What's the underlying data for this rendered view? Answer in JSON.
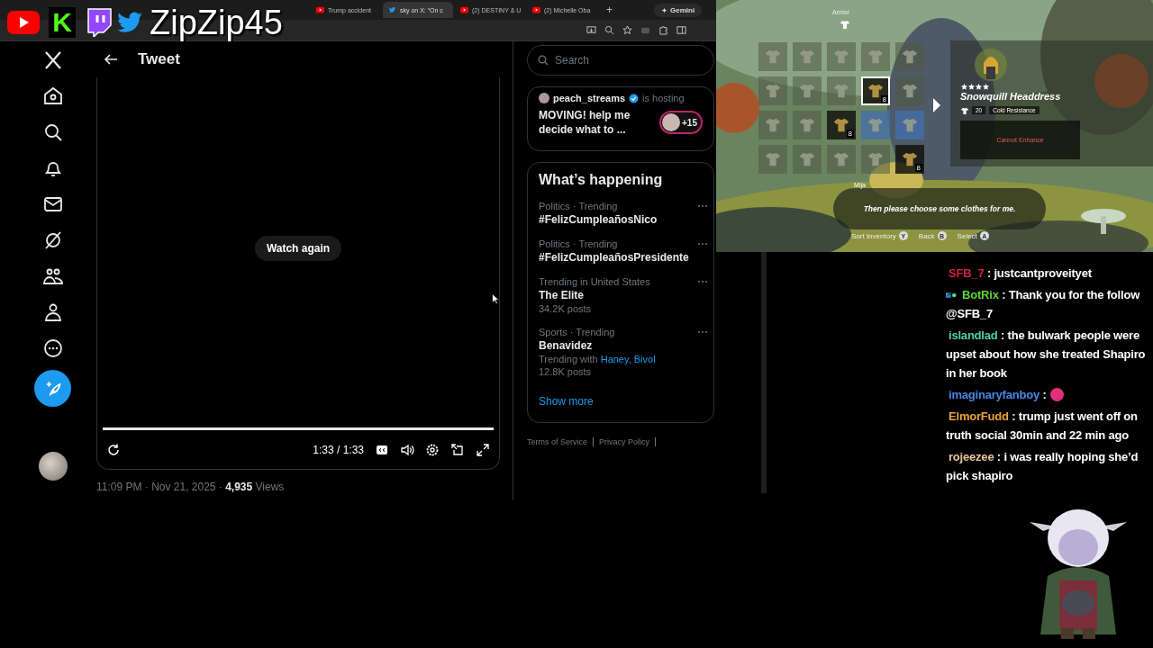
{
  "browser": {
    "tabs": [
      {
        "title": "Trump accident",
        "kind": "youtube",
        "selected": false
      },
      {
        "title": "sky on X: “On c",
        "kind": "twitter",
        "selected": true
      },
      {
        "title": "(2) DESTINY & U",
        "kind": "youtube",
        "selected": false
      },
      {
        "title": "(2) Michelle Oba",
        "kind": "youtube",
        "selected": false
      }
    ],
    "new_tab": "+",
    "pinned_tab": "Gemini"
  },
  "stream_logos": {
    "kick_letter": "K",
    "channel": "ZipZip45"
  },
  "x": {
    "header_title": "Tweet",
    "video": {
      "watch_again": "Watch again",
      "level": 1,
      "time": "1:33 / 1:33"
    },
    "meta": "11:09 PM · Nov 21, 2025 · **4,935** Views",
    "search": {
      "placeholder": "Search"
    },
    "hosting": {
      "user": "peach_streams",
      "verified": true,
      "status": "is hosting",
      "title": "MOVING! help me decide what to ...",
      "viewers": "+15"
    },
    "trends_heading": "What’s happening",
    "trends": [
      {
        "context": "Politics · Trending",
        "title": "#FelizCumpleañosNico"
      },
      {
        "context": "Politics · Trending",
        "title": "#FelizCumpleañosPresidente"
      },
      {
        "context": "Trending in United States",
        "title": "The Elite",
        "posts": "34.2K posts"
      },
      {
        "context": "Sports · Trending",
        "title": "Benavidez",
        "trending_with": "Trending with",
        "links": "Haney, Bivol",
        "posts": "12.8K posts"
      }
    ],
    "show_more": "Show more",
    "footer_links": [
      "Terms of Service",
      "Privacy Policy"
    ]
  },
  "game": {
    "category": "Armor",
    "tiles": [
      {
        "kind": "plain",
        "selected": false
      },
      {
        "kind": "plain",
        "selected": false
      },
      {
        "kind": "plain",
        "selected": false
      },
      {
        "kind": "plain",
        "selected": false
      },
      {
        "kind": "plain",
        "selected": false
      },
      {
        "kind": "plain",
        "selected": false
      },
      {
        "kind": "plain",
        "selected": false
      },
      {
        "kind": "plain",
        "selected": false
      },
      {
        "kind": "dark",
        "selected": true,
        "count": "8"
      },
      {
        "kind": "plain",
        "selected": false
      },
      {
        "kind": "plain",
        "selected": false
      },
      {
        "kind": "plain",
        "selected": false
      },
      {
        "kind": "dark",
        "selected": false,
        "count": "8"
      },
      {
        "kind": "blue",
        "selected": false
      },
      {
        "kind": "blue",
        "selected": false
      },
      {
        "kind": "plain",
        "selected": false
      },
      {
        "kind": "plain",
        "selected": false
      },
      {
        "kind": "plain",
        "selected": false
      },
      {
        "kind": "plain",
        "selected": false
      },
      {
        "kind": "dark",
        "selected": false,
        "count": "8"
      }
    ],
    "item": {
      "stars": 4,
      "name": "Snowquill Headdress",
      "defense": "20",
      "effect": "Cold Resistance",
      "status": "Cannot Enhance"
    },
    "dialog": {
      "speaker": "Mija",
      "line": "Then please choose some clothes for me."
    },
    "hints": [
      {
        "label": "Sort Inventory",
        "button": "Y"
      },
      {
        "label": "Back",
        "button": "B"
      },
      {
        "label": "Select",
        "button": "A"
      }
    ]
  },
  "chat": [
    {
      "user": "SFB_7",
      "color": "#d0243c",
      "kind": "text",
      "badges": false,
      "text": ": justcantproveityet"
    },
    {
      "user": "BotRix",
      "color": "#5fd33a",
      "kind": "text",
      "badges": true,
      "text": ": Thank you for the follow @SFB_7"
    },
    {
      "user": "islandlad",
      "color": "#4fd0a8",
      "kind": "text",
      "badges": false,
      "text": ": the bulwark people were upset about how she treated Shapiro in her book"
    },
    {
      "user": "imaginaryfanboy",
      "color": "#4a86e8",
      "kind": "emote",
      "badges": false,
      "text": ":"
    },
    {
      "user": "ElmorFudd",
      "color": "#e9a23b",
      "kind": "text",
      "badges": false,
      "text": ": trump just went off on truth social 30min and 22 min ago"
    },
    {
      "user": "rojeezee",
      "color": "#e8c49a",
      "kind": "text",
      "badges": false,
      "text": ": i was really hoping she’d pick shapiro"
    }
  ]
}
